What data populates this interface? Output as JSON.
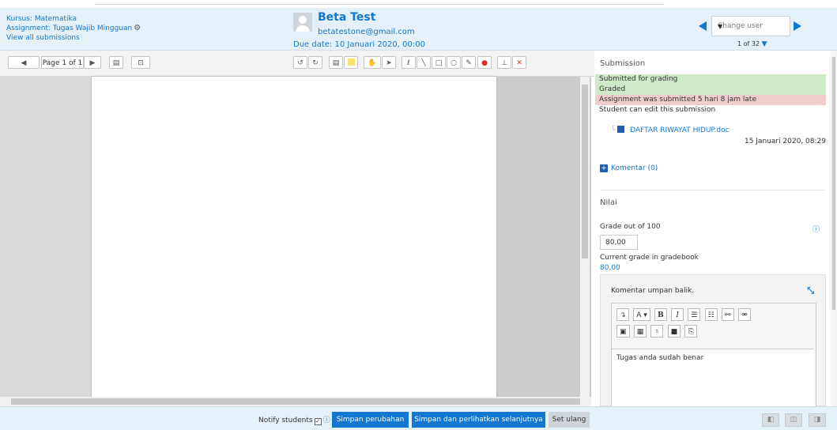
{
  "header": {
    "course": "Kursus: Matematika",
    "assignment": "Assignment: Tugas Wajib Mingguan",
    "view_all": "View all submissions",
    "user_name": "Beta Test",
    "user_email": "betatestone@gmail.com",
    "due_date": "Due date: 10 Januari 2020, 00:00",
    "change_user_placeholder": "Change user",
    "user_count": "1 of 32"
  },
  "toolbar": {
    "page_label": "Page 1 of 1",
    "icons": [
      "prev-page-icon",
      "page-select",
      "next-page-icon",
      "search-comments-icon",
      "expand-comments-icon",
      "rotate-left-icon",
      "rotate-right-icon",
      "comment-icon",
      "highlight-color-icon",
      "pan-icon",
      "select-icon",
      "pen-icon",
      "line-icon",
      "rectangle-icon",
      "oval-icon",
      "highlight-icon",
      "color-icon",
      "stamp-icon",
      "delete-icon"
    ]
  },
  "submission": {
    "heading": "Submission",
    "status_submitted": "Submitted for grading",
    "status_graded": "Graded",
    "status_late": "Assignment was submitted 5 hari 8 jam late",
    "status_edit": "Student can edit this submission",
    "file_name": "DAFTAR RIWAYAT HIDUP.doc",
    "file_date": "15 Januari 2020, 08:29",
    "comments_link": "Komentar (0)"
  },
  "grade": {
    "heading": "Nilai",
    "grade_out_of": "Grade out of 100",
    "grade_value": "80,00",
    "current_label": "Current grade in gradebook",
    "current_value": "80,00",
    "feedback_title": "Komentar umpan balik.",
    "feedback_text": "Tugas anda sudah benar"
  },
  "footer": {
    "notify_label": "Notify students",
    "save_label": "Simpan perubahan",
    "save_next_label": "Simpan dan perlihatkan selanjutnya",
    "reset_label": "Set ulang"
  },
  "colors": {
    "accent": "#1177d1",
    "status_green": "#cfeac7",
    "status_red": "#f1cccc",
    "header_bg": "#e5f1f8"
  }
}
